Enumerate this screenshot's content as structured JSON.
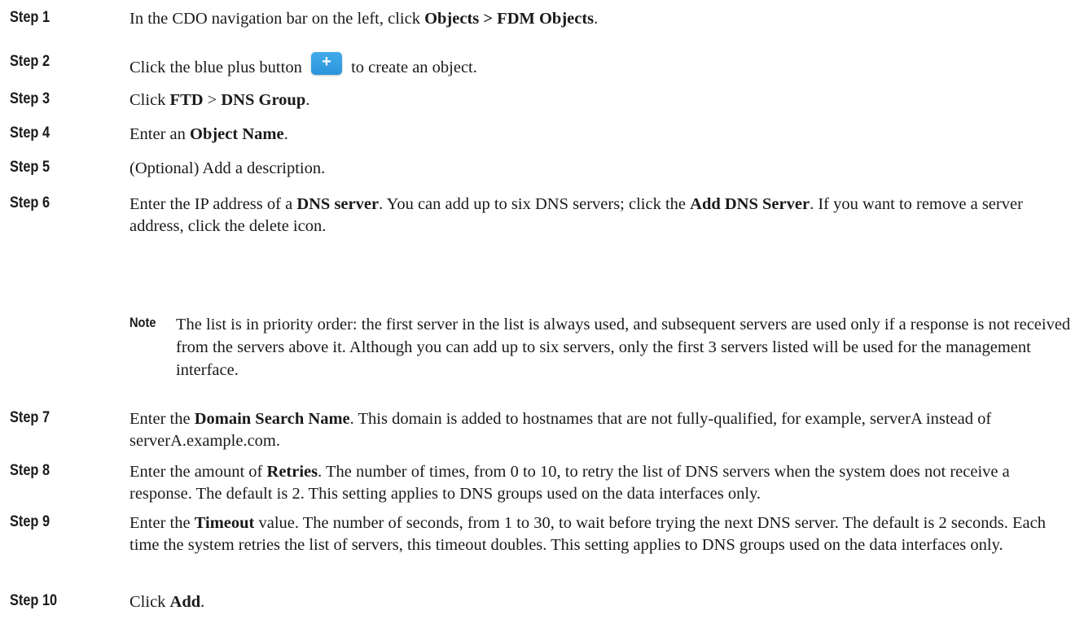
{
  "steps": [
    {
      "label": "Step 1",
      "parts": [
        {
          "t": "In the CDO navigation bar on the left, click "
        },
        {
          "t": "Objects > FDM Objects",
          "b": true
        },
        {
          "t": "."
        }
      ]
    },
    {
      "label": "Step 2",
      "parts": [
        {
          "t": "Click the blue plus button "
        },
        {
          "icon": "plus-button-icon",
          "glyph": "+"
        },
        {
          "t": " to create an object."
        }
      ]
    },
    {
      "label": "Step 3",
      "parts": [
        {
          "t": "Click "
        },
        {
          "t": "FTD",
          "b": true
        },
        {
          "t": " > "
        },
        {
          "t": "DNS Group",
          "b": true
        },
        {
          "t": "."
        }
      ]
    },
    {
      "label": "Step 4",
      "parts": [
        {
          "t": "Enter an "
        },
        {
          "t": "Object Name",
          "b": true
        },
        {
          "t": "."
        }
      ]
    },
    {
      "label": "Step 5",
      "parts": [
        {
          "t": "(Optional) Add a description."
        }
      ]
    },
    {
      "label": "Step 6",
      "parts": [
        {
          "t": "Enter the IP address of a "
        },
        {
          "t": "DNS server",
          "b": true
        },
        {
          "t": ". You can add up to six DNS servers; click the "
        },
        {
          "t": "Add DNS Server",
          "b": true
        },
        {
          "t": ". If you want to remove a server address, click the delete icon."
        }
      ]
    },
    {
      "label": "Step 7",
      "parts": [
        {
          "t": "Enter the "
        },
        {
          "t": "Domain Search Name",
          "b": true
        },
        {
          "t": ". This domain is added to hostnames that are not fully-qualified, for example, serverA instead of serverA.example.com."
        }
      ]
    },
    {
      "label": "Step 8",
      "parts": [
        {
          "t": "Enter the amount of "
        },
        {
          "t": "Retries",
          "b": true
        },
        {
          "t": ". The number of times, from 0 to 10, to retry the list of DNS servers when the system does not receive a response. The default is 2. This setting applies to DNS groups used on the data interfaces only."
        }
      ]
    },
    {
      "label": "Step 9",
      "parts": [
        {
          "t": "Enter the "
        },
        {
          "t": "Timeout",
          "b": true
        },
        {
          "t": " value. The number of seconds, from 1 to 30, to wait before trying the next DNS server. The default is 2 seconds. Each time the system retries the list of servers, this timeout doubles. This setting applies to DNS groups used on the data interfaces only."
        }
      ]
    },
    {
      "label": "Step 10",
      "parts": [
        {
          "t": "Click "
        },
        {
          "t": "Add",
          "b": true
        },
        {
          "t": "."
        }
      ]
    }
  ],
  "note": {
    "label": "Note",
    "text": "The list is in priority order: the first server in the list is always used, and subsequent servers are used only if a response is not received from the servers above it. Although you can add up to six servers, only the first 3 servers listed will be used for the management interface."
  },
  "colors": {
    "plus_button": "#2b95dc",
    "text": "#1a1a1a"
  }
}
